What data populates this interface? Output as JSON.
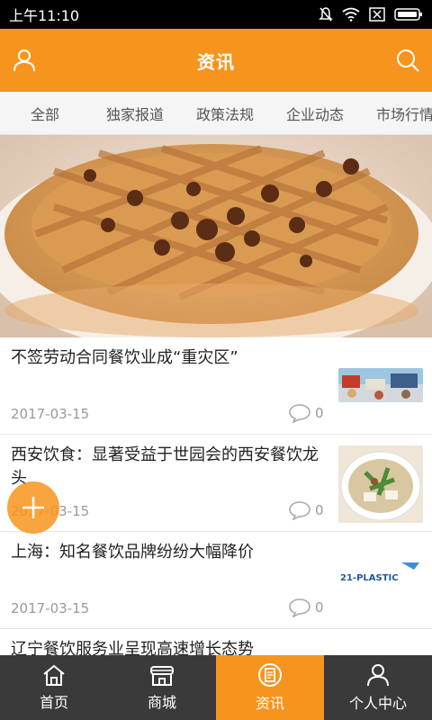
{
  "status": {
    "time": "上午11:10"
  },
  "header": {
    "title": "资讯",
    "left_icon": "user-icon",
    "right_icon": "search-icon"
  },
  "tabs": [
    {
      "label": "全部"
    },
    {
      "label": "独家报道"
    },
    {
      "label": "政策法规"
    },
    {
      "label": "企业动态"
    },
    {
      "label": "市场行情"
    }
  ],
  "news": [
    {
      "title": "不签劳动合同餐饮业成“重灾区”",
      "date": "2017-03-15",
      "comments": "0"
    },
    {
      "title": "西安饮食：显著受益于世园会的西安餐饮龙头",
      "date": "2017-03-15",
      "comments": "0"
    },
    {
      "title": "上海：知名餐饮品牌纷纷大幅降价",
      "date": "2017-03-15",
      "comments": "0",
      "thumb_text": "21-PLASTIC"
    },
    {
      "title": "辽宁餐饮服务业呈现高速增长态势"
    }
  ],
  "bottom_nav": [
    {
      "label": "首页",
      "icon": "home-icon"
    },
    {
      "label": "商城",
      "icon": "shop-icon"
    },
    {
      "label": "资讯",
      "icon": "news-icon",
      "active": true
    },
    {
      "label": "个人中心",
      "icon": "profile-icon"
    }
  ],
  "colors": {
    "accent": "#f7941d",
    "nav_bg": "#3a3a3a"
  }
}
